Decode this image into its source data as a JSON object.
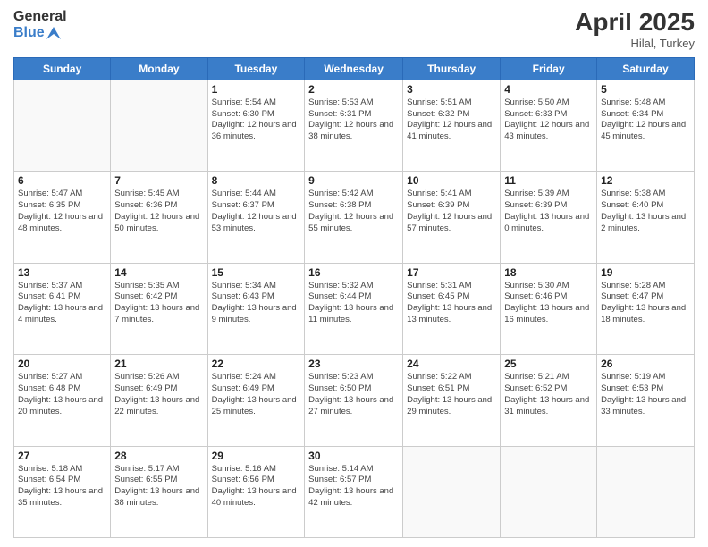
{
  "header": {
    "logo_general": "General",
    "logo_blue": "Blue",
    "title": "April 2025",
    "subtitle": "Hilal, Turkey"
  },
  "days": [
    "Sunday",
    "Monday",
    "Tuesday",
    "Wednesday",
    "Thursday",
    "Friday",
    "Saturday"
  ],
  "weeks": [
    [
      {
        "num": "",
        "info": ""
      },
      {
        "num": "",
        "info": ""
      },
      {
        "num": "1",
        "info": "Sunrise: 5:54 AM\nSunset: 6:30 PM\nDaylight: 12 hours and 36 minutes."
      },
      {
        "num": "2",
        "info": "Sunrise: 5:53 AM\nSunset: 6:31 PM\nDaylight: 12 hours and 38 minutes."
      },
      {
        "num": "3",
        "info": "Sunrise: 5:51 AM\nSunset: 6:32 PM\nDaylight: 12 hours and 41 minutes."
      },
      {
        "num": "4",
        "info": "Sunrise: 5:50 AM\nSunset: 6:33 PM\nDaylight: 12 hours and 43 minutes."
      },
      {
        "num": "5",
        "info": "Sunrise: 5:48 AM\nSunset: 6:34 PM\nDaylight: 12 hours and 45 minutes."
      }
    ],
    [
      {
        "num": "6",
        "info": "Sunrise: 5:47 AM\nSunset: 6:35 PM\nDaylight: 12 hours and 48 minutes."
      },
      {
        "num": "7",
        "info": "Sunrise: 5:45 AM\nSunset: 6:36 PM\nDaylight: 12 hours and 50 minutes."
      },
      {
        "num": "8",
        "info": "Sunrise: 5:44 AM\nSunset: 6:37 PM\nDaylight: 12 hours and 53 minutes."
      },
      {
        "num": "9",
        "info": "Sunrise: 5:42 AM\nSunset: 6:38 PM\nDaylight: 12 hours and 55 minutes."
      },
      {
        "num": "10",
        "info": "Sunrise: 5:41 AM\nSunset: 6:39 PM\nDaylight: 12 hours and 57 minutes."
      },
      {
        "num": "11",
        "info": "Sunrise: 5:39 AM\nSunset: 6:39 PM\nDaylight: 13 hours and 0 minutes."
      },
      {
        "num": "12",
        "info": "Sunrise: 5:38 AM\nSunset: 6:40 PM\nDaylight: 13 hours and 2 minutes."
      }
    ],
    [
      {
        "num": "13",
        "info": "Sunrise: 5:37 AM\nSunset: 6:41 PM\nDaylight: 13 hours and 4 minutes."
      },
      {
        "num": "14",
        "info": "Sunrise: 5:35 AM\nSunset: 6:42 PM\nDaylight: 13 hours and 7 minutes."
      },
      {
        "num": "15",
        "info": "Sunrise: 5:34 AM\nSunset: 6:43 PM\nDaylight: 13 hours and 9 minutes."
      },
      {
        "num": "16",
        "info": "Sunrise: 5:32 AM\nSunset: 6:44 PM\nDaylight: 13 hours and 11 minutes."
      },
      {
        "num": "17",
        "info": "Sunrise: 5:31 AM\nSunset: 6:45 PM\nDaylight: 13 hours and 13 minutes."
      },
      {
        "num": "18",
        "info": "Sunrise: 5:30 AM\nSunset: 6:46 PM\nDaylight: 13 hours and 16 minutes."
      },
      {
        "num": "19",
        "info": "Sunrise: 5:28 AM\nSunset: 6:47 PM\nDaylight: 13 hours and 18 minutes."
      }
    ],
    [
      {
        "num": "20",
        "info": "Sunrise: 5:27 AM\nSunset: 6:48 PM\nDaylight: 13 hours and 20 minutes."
      },
      {
        "num": "21",
        "info": "Sunrise: 5:26 AM\nSunset: 6:49 PM\nDaylight: 13 hours and 22 minutes."
      },
      {
        "num": "22",
        "info": "Sunrise: 5:24 AM\nSunset: 6:49 PM\nDaylight: 13 hours and 25 minutes."
      },
      {
        "num": "23",
        "info": "Sunrise: 5:23 AM\nSunset: 6:50 PM\nDaylight: 13 hours and 27 minutes."
      },
      {
        "num": "24",
        "info": "Sunrise: 5:22 AM\nSunset: 6:51 PM\nDaylight: 13 hours and 29 minutes."
      },
      {
        "num": "25",
        "info": "Sunrise: 5:21 AM\nSunset: 6:52 PM\nDaylight: 13 hours and 31 minutes."
      },
      {
        "num": "26",
        "info": "Sunrise: 5:19 AM\nSunset: 6:53 PM\nDaylight: 13 hours and 33 minutes."
      }
    ],
    [
      {
        "num": "27",
        "info": "Sunrise: 5:18 AM\nSunset: 6:54 PM\nDaylight: 13 hours and 35 minutes."
      },
      {
        "num": "28",
        "info": "Sunrise: 5:17 AM\nSunset: 6:55 PM\nDaylight: 13 hours and 38 minutes."
      },
      {
        "num": "29",
        "info": "Sunrise: 5:16 AM\nSunset: 6:56 PM\nDaylight: 13 hours and 40 minutes."
      },
      {
        "num": "30",
        "info": "Sunrise: 5:14 AM\nSunset: 6:57 PM\nDaylight: 13 hours and 42 minutes."
      },
      {
        "num": "",
        "info": ""
      },
      {
        "num": "",
        "info": ""
      },
      {
        "num": "",
        "info": ""
      }
    ]
  ]
}
